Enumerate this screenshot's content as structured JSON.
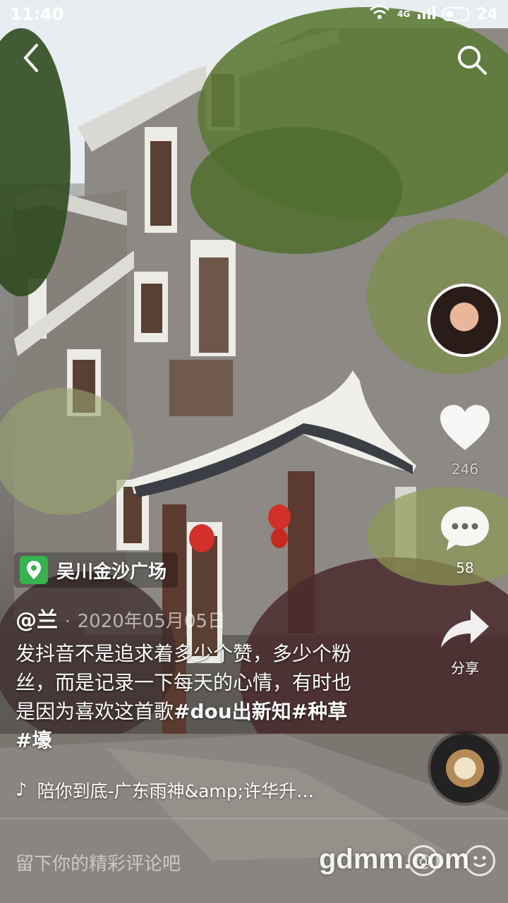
{
  "status_bar": {
    "time": "11:40",
    "network": "4G",
    "battery": "24"
  },
  "side_actions": {
    "likes": "246",
    "comments": "58",
    "share_label": "分享"
  },
  "location": "吴川金沙广场",
  "author": "@兰",
  "separator": "·",
  "date": "2020年05月05日",
  "caption": {
    "text": "发抖音不是追求着多少个赞，多少个粉丝，而是记录一下每天的心情，有时也是因为喜欢这首歌",
    "tags": "#dou出新知#种草 #壕"
  },
  "music": {
    "title": "陪你到底-广东雨神&amp;许华升…"
  },
  "comment_bar": {
    "placeholder": "留下你的精彩评论吧",
    "at_symbol": "@"
  },
  "watermark": "gdmm.com",
  "icons": [
    "back-arrow-icon",
    "search-icon",
    "heart-icon",
    "comment-bubble-icon",
    "share-arrow-icon",
    "location-pin-icon",
    "music-note-icon",
    "at-icon",
    "emoji-icon"
  ]
}
